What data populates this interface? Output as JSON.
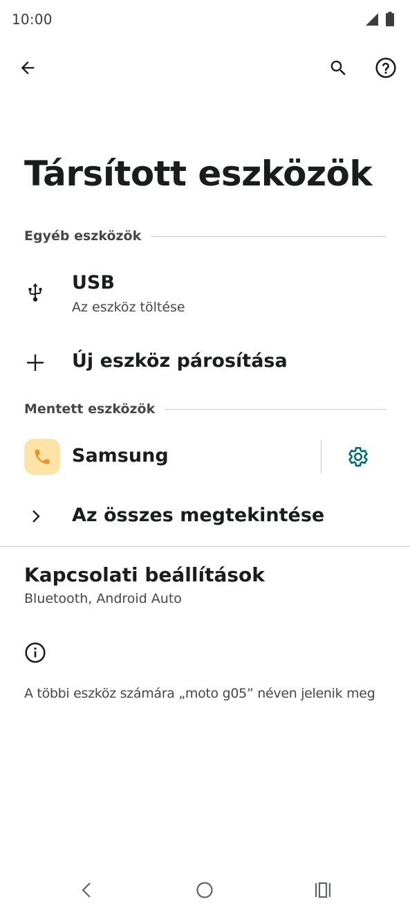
{
  "status_bar": {
    "time": "10:00"
  },
  "page": {
    "title": "Társított eszközök"
  },
  "sections": {
    "other_devices": "Egyéb eszközök",
    "saved_devices": "Mentett eszközök"
  },
  "usb": {
    "title": "USB",
    "subtitle": "Az eszköz töltése"
  },
  "pair_new": {
    "label": "Új eszköz párosítása"
  },
  "saved": {
    "device_name": "Samsung"
  },
  "see_all": {
    "label": "Az összes megtekintése"
  },
  "connection_prefs": {
    "title": "Kapcsolati beállítások",
    "subtitle": "Bluetooth, Android Auto"
  },
  "footer": {
    "text": "A többi eszköz számára „moto g05” néven jelenik meg"
  },
  "icons": {
    "back": "arrow-back-icon",
    "search": "search-icon",
    "help": "help-icon",
    "usb": "usb-icon",
    "add": "plus-icon",
    "phone": "phone-icon",
    "settings": "gear-icon",
    "expand": "chevron-right-icon",
    "info": "info-icon"
  },
  "colors": {
    "accent": "#006a6a",
    "phone_badge_bg": "#fde3a6",
    "phone_icon": "#e8912d",
    "text_primary": "#1b1c1c",
    "text_secondary": "#444746",
    "divider": "#c4c7c5"
  }
}
